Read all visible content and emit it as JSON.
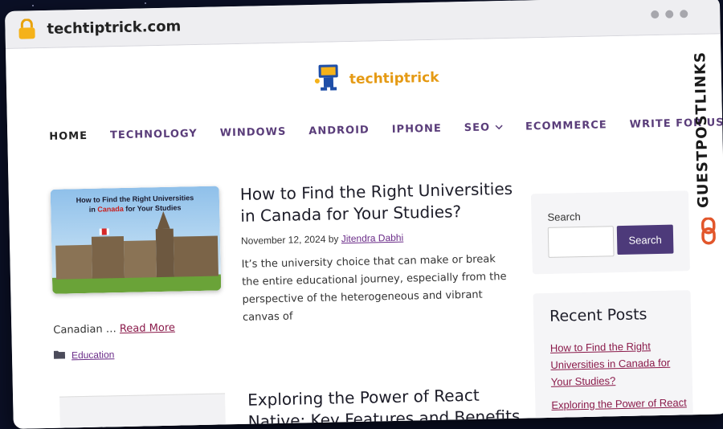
{
  "browser": {
    "url": "techtiptrick.com"
  },
  "site": {
    "logo_text": "techtiptrick"
  },
  "nav": {
    "items": [
      {
        "label": "HOME"
      },
      {
        "label": "TECHNOLOGY"
      },
      {
        "label": "WINDOWS"
      },
      {
        "label": "ANDROID"
      },
      {
        "label": "IPHONE"
      },
      {
        "label": "SEO"
      },
      {
        "label": "ECOMMERCE"
      },
      {
        "label": "WRITE FOR US"
      }
    ]
  },
  "post1": {
    "thumb_title_line1": "How to Find the Right Universities",
    "thumb_title_line2_pre": "in ",
    "thumb_title_line2_red": "Canada",
    "thumb_title_line2_post": " for Your Studies",
    "title": "How to Find the Right Universities in Canada for Your Studies?",
    "date": "November 12, 2024",
    "by": "by",
    "author": "Jitendra Dabhi",
    "excerpt": "It’s the university choice that can make or break the entire educational journey, especially from the perspective of the heterogeneous and vibrant canvas of",
    "excerpt_tail": "Canadian …",
    "read_more": "Read More",
    "category": "Education"
  },
  "post2": {
    "title": "Exploring the Power of React Native: Key Features and Benefits"
  },
  "sidebar": {
    "search_label": "Search",
    "search_button": "Search",
    "search_value": "",
    "recent_title": "Recent Posts",
    "recent_posts": [
      "How to Find the Right Universities in Canada for Your Studies?",
      "Exploring the Power of React Native: Key Features"
    ]
  },
  "brand": {
    "text": "GUESTPOSTLINKS"
  },
  "colors": {
    "accent": "#4d3a7a",
    "link": "#8a1a4a",
    "logo": "#e59a14",
    "brand_icon": "#e2562b"
  }
}
